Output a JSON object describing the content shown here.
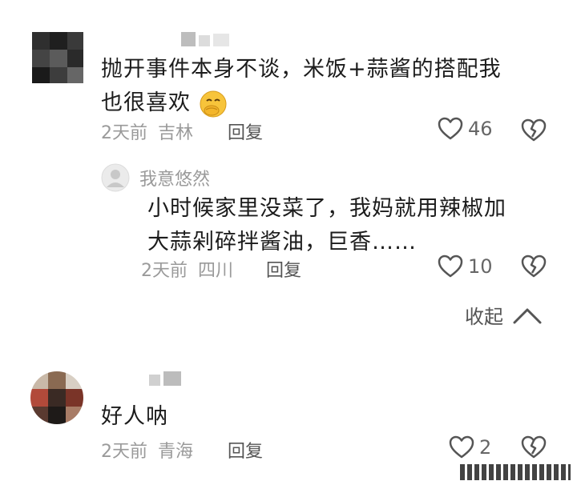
{
  "comments": [
    {
      "text_line1": "抛开事件本身不谈，米饭+蒜酱的搭配我",
      "text_line2": "也很喜欢",
      "emoji": "smirk-hand-emoji",
      "time": "2天前",
      "location": "吉林",
      "reply_label": "回复",
      "likes": "46",
      "replies": [
        {
          "username": "我意悠然",
          "text_line1": "小时候家里没菜了，我妈就用辣椒加",
          "text_line2": "大蒜剁碎拌酱油，巨香……",
          "time": "2天前",
          "location": "四川",
          "reply_label": "回复",
          "likes": "10"
        }
      ],
      "collapse_label": "收起"
    },
    {
      "text_line1": "好人呐",
      "time": "2天前",
      "location": "青海",
      "reply_label": "回复",
      "likes": "2"
    }
  ],
  "colors": {
    "text": "#1c1c1c",
    "meta": "#9a9a9a",
    "icon": "#555555",
    "emoji": "#f7c43b"
  }
}
